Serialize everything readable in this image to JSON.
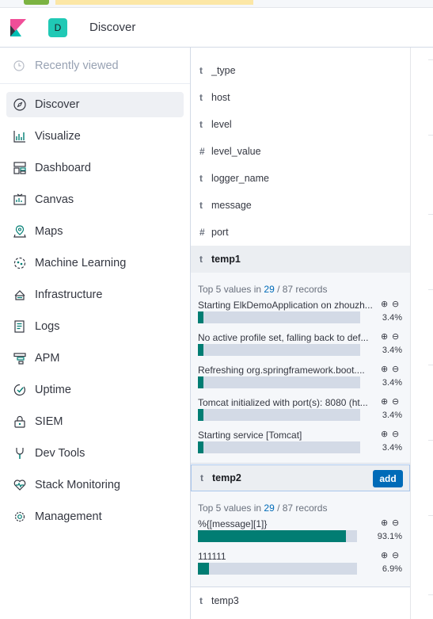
{
  "header": {
    "space_initial": "D",
    "breadcrumb": "Discover"
  },
  "nav": {
    "recent": "Recently viewed",
    "items": [
      {
        "label": "Discover",
        "icon": "compass-icon",
        "active": true
      },
      {
        "label": "Visualize",
        "icon": "visualize-icon"
      },
      {
        "label": "Dashboard",
        "icon": "dashboard-icon"
      },
      {
        "label": "Canvas",
        "icon": "canvas-icon"
      },
      {
        "label": "Maps",
        "icon": "maps-icon"
      },
      {
        "label": "Machine Learning",
        "icon": "machine-learning-icon"
      },
      {
        "label": "Infrastructure",
        "icon": "infrastructure-icon"
      },
      {
        "label": "Logs",
        "icon": "logs-icon"
      },
      {
        "label": "APM",
        "icon": "apm-icon"
      },
      {
        "label": "Uptime",
        "icon": "uptime-icon"
      },
      {
        "label": "SIEM",
        "icon": "siem-icon"
      },
      {
        "label": "Dev Tools",
        "icon": "dev-tools-icon"
      },
      {
        "label": "Stack Monitoring",
        "icon": "stack-monitoring-icon"
      },
      {
        "label": "Management",
        "icon": "gear-icon"
      }
    ]
  },
  "fields": [
    {
      "type": "t",
      "name": "_type"
    },
    {
      "type": "t",
      "name": "host"
    },
    {
      "type": "t",
      "name": "level"
    },
    {
      "type": "#",
      "name": "level_value"
    },
    {
      "type": "t",
      "name": "logger_name"
    },
    {
      "type": "t",
      "name": "message"
    },
    {
      "type": "#",
      "name": "port"
    }
  ],
  "temp1": {
    "type": "t",
    "name": "temp1",
    "summary_prefix": "Top 5 values in ",
    "summary_count": "29",
    "summary_suffix": " / 87 records",
    "buckets": [
      {
        "label": "Starting ElkDemoApplication on zhouzh...",
        "percent": "3.4%",
        "fraction": 0.034
      },
      {
        "label": "No active profile set, falling back to def...",
        "percent": "3.4%",
        "fraction": 0.034
      },
      {
        "label": "Refreshing org.springframework.boot....",
        "percent": "3.4%",
        "fraction": 0.034
      },
      {
        "label": "Tomcat initialized with port(s): 8080 (ht...",
        "percent": "3.4%",
        "fraction": 0.034
      },
      {
        "label": "Starting service [Tomcat]",
        "percent": "3.4%",
        "fraction": 0.034
      }
    ]
  },
  "temp2": {
    "type": "t",
    "name": "temp2",
    "add_label": "add",
    "summary_prefix": "Top 5 values in ",
    "summary_count": "29",
    "summary_suffix": " / 87 records",
    "buckets": [
      {
        "label": "%{[message][1]}",
        "percent": "93.1%",
        "fraction": 0.931
      },
      {
        "label": "111111",
        "percent": "6.9%",
        "fraction": 0.069
      }
    ]
  },
  "temp3": {
    "type": "t",
    "name": "temp3"
  },
  "colors": {
    "accent": "#006bb8",
    "bar_fill": "#017d73",
    "bar_bg": "#d3dae6"
  }
}
